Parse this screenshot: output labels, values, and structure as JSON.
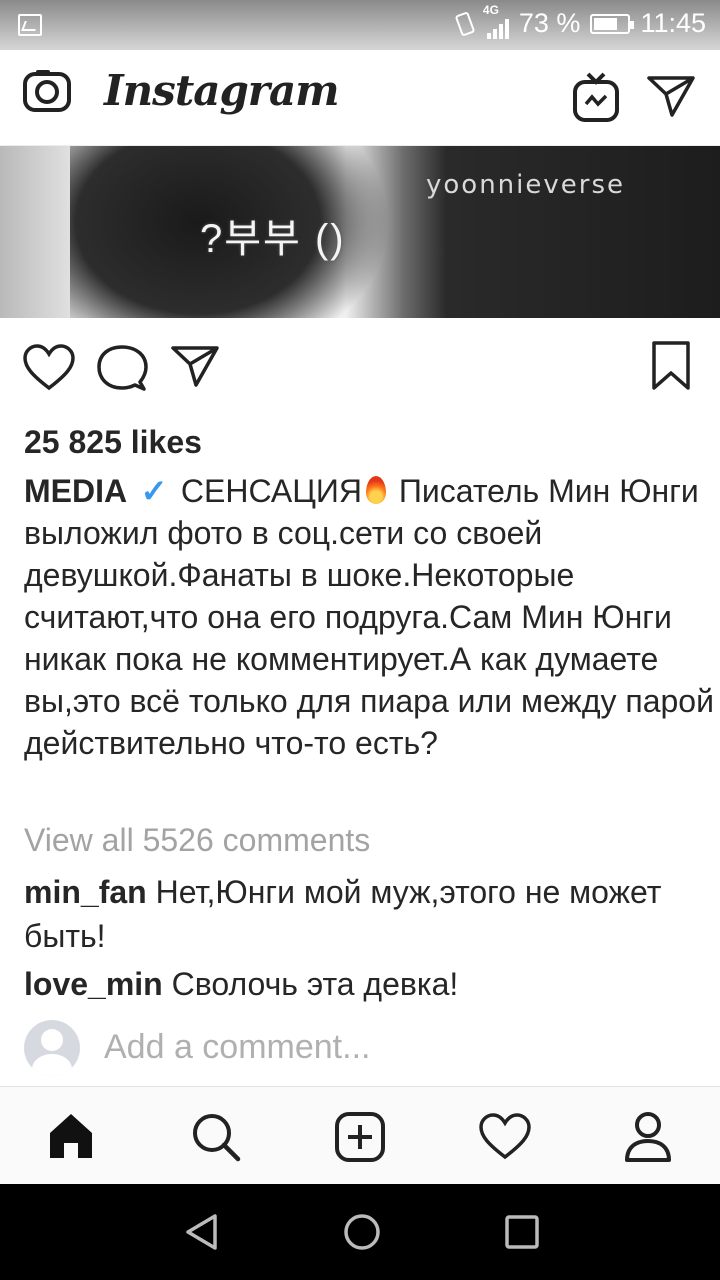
{
  "status_bar": {
    "network": "4G",
    "battery_percent": "73 %",
    "battery_level": 0.73,
    "time": "11:45"
  },
  "header": {
    "logo": "Instagram",
    "icons": [
      "camera-icon",
      "igtv-icon",
      "direct-send-icon"
    ]
  },
  "post": {
    "image": {
      "watermark": "yoonnieverse",
      "overlay_text": "?부부 ()"
    },
    "actions": [
      "heart-icon",
      "comment-icon",
      "share-icon",
      "bookmark-icon"
    ],
    "likes": "25 825 likes",
    "author": "MEDIA",
    "caption_part1": "СЕНСАЦИЯ",
    "caption_part2": " Писатель Мин Юнги выложил фото в соц.сети со своей девушкой.Фанаты в шоке.Некоторые считают,что она его подруга.Сам Мин Юнги никак пока не комментирует.А как думаете вы,это всё только для пиара или между парой действительно что-то есть?",
    "view_all_comments": "View all 5526 comments",
    "comments": [
      {
        "user": "min_fan",
        "text": "Нет,Юнги мой муж,этого не может быть!"
      },
      {
        "user": "love_min",
        "text": "Сволочь эта девка!"
      }
    ],
    "add_comment_placeholder": "Add a comment..."
  },
  "bottom_nav": [
    "home-icon",
    "search-icon",
    "add-post-icon",
    "activity-heart-icon",
    "profile-icon"
  ],
  "system_nav": [
    "back-icon",
    "home-circle-icon",
    "recents-icon"
  ],
  "colors": {
    "verified": "#3897f0",
    "muted_text": "#a3a3a3"
  }
}
